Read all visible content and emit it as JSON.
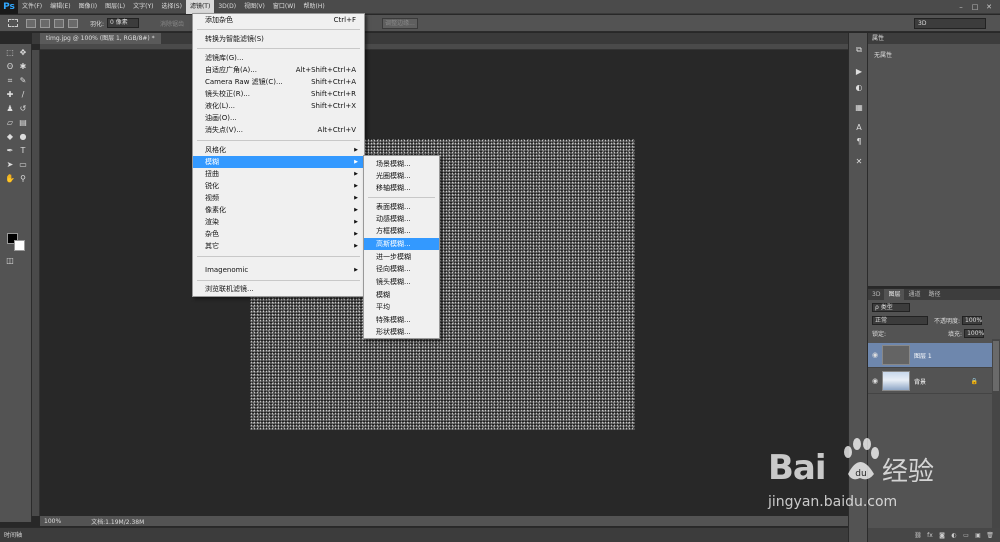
{
  "app": {
    "logo": "Ps"
  },
  "menubar": {
    "items": [
      "文件(F)",
      "编辑(E)",
      "图像(I)",
      "图层(L)",
      "文字(Y)",
      "选择(S)",
      "滤镜(T)",
      "3D(D)",
      "视图(V)",
      "窗口(W)",
      "帮助(H)"
    ],
    "active_index": 6,
    "window_controls": [
      "–",
      "□",
      "✕"
    ]
  },
  "options_bar": {
    "feather_label": "羽化:",
    "feather_value": "0 像素",
    "antialias_label": "消除锯齿",
    "refine_edge_label": "调整边缘...",
    "workspace_select": "3D"
  },
  "document": {
    "tab_label": "timg.jpg @ 100% (图层 1, RGB/8#) *",
    "zoom": "100%",
    "doc_info": "文档:1.19M/2.38M"
  },
  "timeline_tab": "时间轴",
  "filter_menu": {
    "items": [
      {
        "label": "添加杂色",
        "shortcut": "Ctrl+F"
      },
      {
        "label": "转换为智能滤镜(S)"
      },
      {
        "label": "滤镜库(G)..."
      },
      {
        "label": "自适应广角(A)...",
        "shortcut": "Alt+Shift+Ctrl+A"
      },
      {
        "label": "Camera Raw 滤镜(C)...",
        "shortcut": "Shift+Ctrl+A"
      },
      {
        "label": "镜头校正(R)...",
        "shortcut": "Shift+Ctrl+R"
      },
      {
        "label": "液化(L)...",
        "shortcut": "Shift+Ctrl+X"
      },
      {
        "label": "油画(O)..."
      },
      {
        "label": "消失点(V)...",
        "shortcut": "Alt+Ctrl+V"
      },
      {
        "label": "风格化",
        "submenu": true
      },
      {
        "label": "模糊",
        "submenu": true,
        "highlighted": true
      },
      {
        "label": "扭曲",
        "submenu": true
      },
      {
        "label": "锐化",
        "submenu": true
      },
      {
        "label": "视频",
        "submenu": true
      },
      {
        "label": "像素化",
        "submenu": true
      },
      {
        "label": "渲染",
        "submenu": true
      },
      {
        "label": "杂色",
        "submenu": true
      },
      {
        "label": "其它",
        "submenu": true
      },
      {
        "label": "Imagenomic",
        "submenu": true
      },
      {
        "label": "浏览联机滤镜..."
      }
    ]
  },
  "blur_submenu": {
    "items": [
      "场景模糊...",
      "光圈模糊...",
      "移轴模糊...",
      "表面模糊...",
      "动感模糊...",
      "方框模糊...",
      "高斯模糊...",
      "进一步模糊",
      "径向模糊...",
      "镜头模糊...",
      "模糊",
      "平均",
      "特殊模糊...",
      "形状模糊..."
    ],
    "highlighted_index": 6
  },
  "properties_panel": {
    "title": "属性",
    "body": "无属性"
  },
  "layers_panel": {
    "tabs": [
      "3D",
      "图层",
      "通道",
      "路径"
    ],
    "active_tab": 1,
    "kind_filter": "ρ 类型",
    "blend_mode": "正常",
    "opacity_label": "不透明度:",
    "opacity_value": "100%",
    "lock_label": "锁定:",
    "fill_label": "填充:",
    "fill_value": "100%",
    "layers": [
      {
        "name": "图层 1",
        "selected": true
      },
      {
        "name": "背景",
        "locked": true
      }
    ],
    "footer_icons": [
      "link-icon",
      "fx-icon",
      "mask-icon",
      "adjustment-icon",
      "group-icon",
      "new-layer-icon",
      "trash-icon"
    ]
  },
  "watermark": {
    "brand": "Bai",
    "brand_cn": "经验",
    "url": "jingyan.baidu.com"
  }
}
